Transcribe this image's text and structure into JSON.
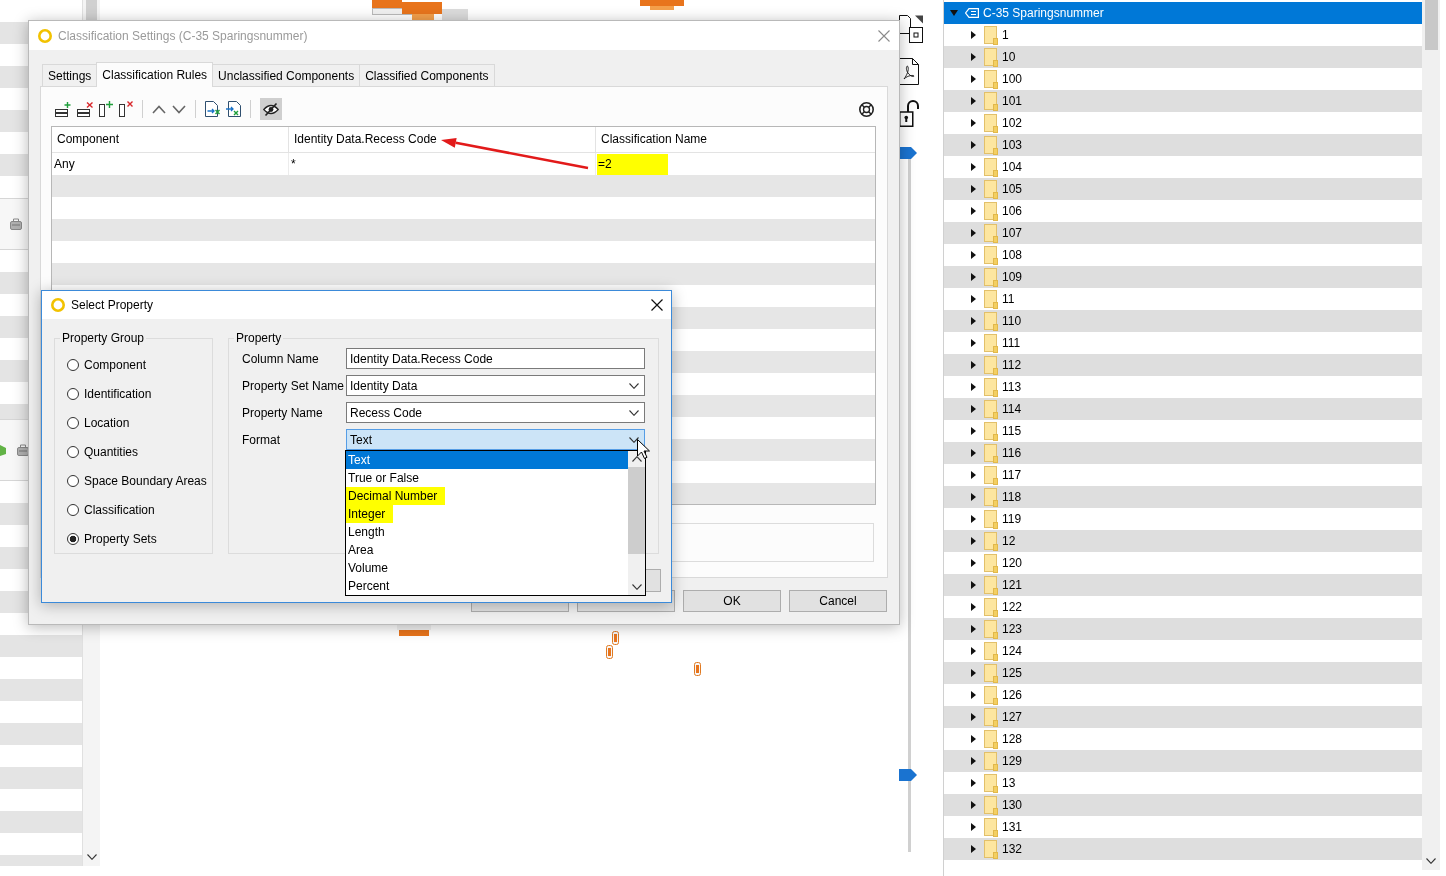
{
  "classification_dialog": {
    "title": "Classification Settings (C-35 Sparingsnummer)",
    "active": false,
    "tabs": [
      {
        "label": "Settings",
        "selected": false
      },
      {
        "label": "Classification Rules",
        "selected": true
      },
      {
        "label": "Unclassified Components",
        "selected": false
      },
      {
        "label": "Classified Components",
        "selected": false
      }
    ],
    "toolbar": {
      "hide_toggle": {
        "on": true
      }
    },
    "table": {
      "columns": [
        "Component",
        "Identity Data.Recess Code",
        "Classification Name"
      ],
      "rows": [
        {
          "cells": [
            {
              "text": "Any",
              "highlighted": false
            },
            {
              "text": "*",
              "highlighted": false
            },
            {
              "text": "=2",
              "highlighted": true
            }
          ]
        }
      ]
    },
    "buttons": [
      {
        "label": "OK"
      },
      {
        "label": "Cancel"
      }
    ]
  },
  "select_property_dialog": {
    "title": "Select Property",
    "active": true,
    "property_group": {
      "title": "Property Group",
      "options": [
        {
          "label": "Component",
          "selected": false
        },
        {
          "label": "Identification",
          "selected": false
        },
        {
          "label": "Location",
          "selected": false
        },
        {
          "label": "Quantities",
          "selected": false
        },
        {
          "label": "Space Boundary Areas",
          "selected": false
        },
        {
          "label": "Classification",
          "selected": false
        },
        {
          "label": "Property Sets",
          "selected": true
        }
      ]
    },
    "property": {
      "title": "Property",
      "fields": [
        {
          "kind": "text",
          "label": "Column Name",
          "value": "Identity Data.Recess Code",
          "focused": false
        },
        {
          "kind": "dropdown",
          "label": "Property Set Name",
          "value": "Identity Data",
          "focused": false,
          "expanded": false
        },
        {
          "kind": "dropdown",
          "label": "Property Name",
          "value": "Recess Code",
          "focused": false,
          "expanded": false
        },
        {
          "kind": "dropdown",
          "label": "Format",
          "value": "Text",
          "focused": true,
          "expanded": true
        }
      ]
    },
    "format_options": [
      {
        "label": "Text",
        "selected": true,
        "highlighted": false
      },
      {
        "label": "True or False",
        "selected": false,
        "highlighted": false
      },
      {
        "label": "Decimal Number",
        "selected": false,
        "highlighted": true
      },
      {
        "label": "Integer",
        "selected": false,
        "highlighted": true
      },
      {
        "label": "Length",
        "selected": false,
        "highlighted": false
      },
      {
        "label": "Area",
        "selected": false,
        "highlighted": false
      },
      {
        "label": "Volume",
        "selected": false,
        "highlighted": false
      },
      {
        "label": "Percent",
        "selected": false,
        "highlighted": false
      }
    ]
  },
  "model_tree": {
    "label": "C-35 Sparingsnummer",
    "expanded": true,
    "selected": true,
    "children": [
      {
        "label": "1",
        "expanded": false,
        "selected": false
      },
      {
        "label": "10",
        "expanded": false,
        "selected": false
      },
      {
        "label": "100",
        "expanded": false,
        "selected": false
      },
      {
        "label": "101",
        "expanded": false,
        "selected": false
      },
      {
        "label": "102",
        "expanded": false,
        "selected": false
      },
      {
        "label": "103",
        "expanded": false,
        "selected": false
      },
      {
        "label": "104",
        "expanded": false,
        "selected": false
      },
      {
        "label": "105",
        "expanded": false,
        "selected": false
      },
      {
        "label": "106",
        "expanded": false,
        "selected": false
      },
      {
        "label": "107",
        "expanded": false,
        "selected": false
      },
      {
        "label": "108",
        "expanded": false,
        "selected": false
      },
      {
        "label": "109",
        "expanded": false,
        "selected": false
      },
      {
        "label": "11",
        "expanded": false,
        "selected": false
      },
      {
        "label": "110",
        "expanded": false,
        "selected": false
      },
      {
        "label": "111",
        "expanded": false,
        "selected": false
      },
      {
        "label": "112",
        "expanded": false,
        "selected": false
      },
      {
        "label": "113",
        "expanded": false,
        "selected": false
      },
      {
        "label": "114",
        "expanded": false,
        "selected": false
      },
      {
        "label": "115",
        "expanded": false,
        "selected": false
      },
      {
        "label": "116",
        "expanded": false,
        "selected": false
      },
      {
        "label": "117",
        "expanded": false,
        "selected": false
      },
      {
        "label": "118",
        "expanded": false,
        "selected": false
      },
      {
        "label": "119",
        "expanded": false,
        "selected": false
      },
      {
        "label": "12",
        "expanded": false,
        "selected": false
      },
      {
        "label": "120",
        "expanded": false,
        "selected": false
      },
      {
        "label": "121",
        "expanded": false,
        "selected": false
      },
      {
        "label": "122",
        "expanded": false,
        "selected": false
      },
      {
        "label": "123",
        "expanded": false,
        "selected": false
      },
      {
        "label": "124",
        "expanded": false,
        "selected": false
      },
      {
        "label": "125",
        "expanded": false,
        "selected": false
      },
      {
        "label": "126",
        "expanded": false,
        "selected": false
      },
      {
        "label": "127",
        "expanded": false,
        "selected": false
      },
      {
        "label": "128",
        "expanded": false,
        "selected": false
      },
      {
        "label": "129",
        "expanded": false,
        "selected": false
      },
      {
        "label": "13",
        "expanded": false,
        "selected": false
      },
      {
        "label": "130",
        "expanded": false,
        "selected": false
      },
      {
        "label": "131",
        "expanded": false,
        "selected": false
      },
      {
        "label": "132",
        "expanded": false,
        "selected": false
      }
    ]
  }
}
